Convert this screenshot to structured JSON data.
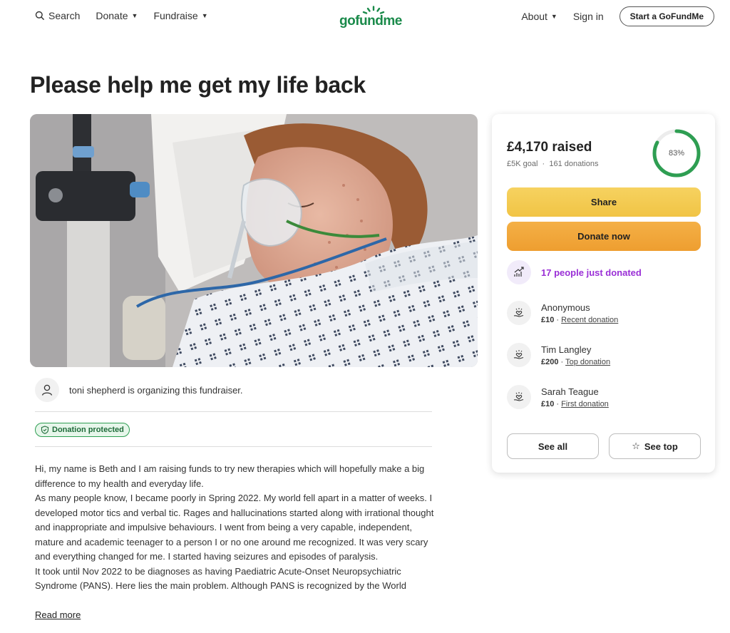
{
  "header": {
    "search_label": "Search",
    "donate_label": "Donate",
    "fundraise_label": "Fundraise",
    "logo_text": "gofundme",
    "about_label": "About",
    "signin_label": "Sign in",
    "start_label": "Start a GoFundMe"
  },
  "campaign": {
    "title": "Please help me get my life back",
    "organizer_text": "toni shepherd is organizing this fundraiser.",
    "protected_label": "Donation protected",
    "story": [
      "Hi, my name is Beth and I am raising funds to try new therapies which will hopefully make a big difference to my health and everyday life.",
      "As many people know, I became poorly in Spring 2022. My world fell apart in a matter of weeks. I developed motor tics and verbal tic. Rages and hallucinations started along with irrational thought and inappropriate and impulsive behaviours. I went from being a very capable, independent, mature and academic teenager to a person I or no one around me recognized. It was very scary and everything changed for me. I started having seizures and episodes of paralysis.",
      "It took until Nov 2022 to be diagnoses as having Paediatric Acute-Onset Neuropsychiatric Syndrome (PANS). Here lies the main problem. Although PANS is recognized by the World"
    ],
    "read_more": "Read more"
  },
  "donation_card": {
    "raised": "£4,170 raised",
    "goal": "£5K goal",
    "donations": "161 donations",
    "progress_percent": 83,
    "progress_label": "83%",
    "share_label": "Share",
    "donate_label": "Donate now",
    "just_donated": "17 people just donated",
    "donors": [
      {
        "name": "Anonymous",
        "amount": "£10",
        "tag": "Recent donation"
      },
      {
        "name": "Tim Langley",
        "amount": "£200",
        "tag": "Top donation"
      },
      {
        "name": "Sarah Teague",
        "amount": "£10",
        "tag": "First donation"
      }
    ],
    "see_all_label": "See all",
    "see_top_label": "See top"
  },
  "colors": {
    "brand_green": "#1a8a4a",
    "progress_green": "#2e9e52",
    "share_yellow": "#f1c445",
    "donate_orange": "#ee9e30",
    "activity_purple": "#9a2fd6"
  }
}
